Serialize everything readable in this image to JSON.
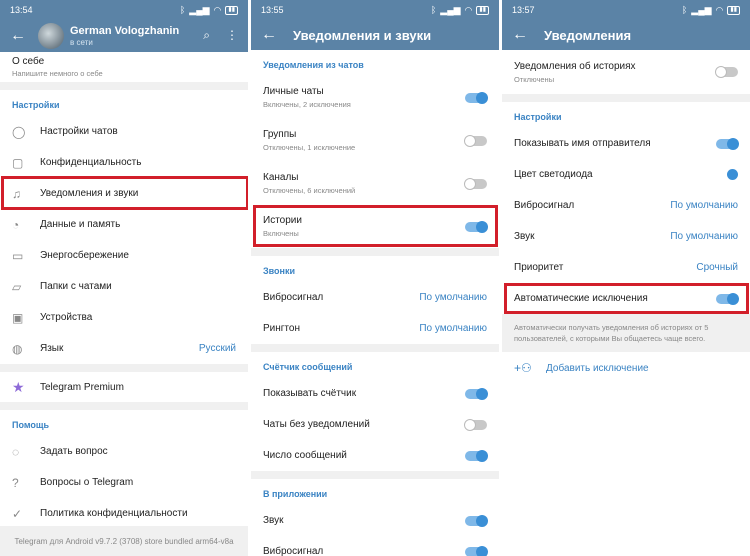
{
  "screen1": {
    "time": "13:54",
    "profile_name": "German Vologzhanin",
    "profile_status": "в сети",
    "about_label": "О себе",
    "about_hint": "Напишите немного о себе",
    "settings_title": "Настройки",
    "items": [
      {
        "label": "Настройки чатов",
        "icon": "chat-bubble-icon"
      },
      {
        "label": "Конфиденциальность",
        "icon": "lock-icon"
      },
      {
        "label": "Уведомления и звуки",
        "icon": "bell-icon"
      },
      {
        "label": "Данные и память",
        "icon": "pie-icon"
      },
      {
        "label": "Энергосбережение",
        "icon": "battery-icon"
      },
      {
        "label": "Папки с чатами",
        "icon": "folder-icon"
      },
      {
        "label": "Устройства",
        "icon": "devices-icon"
      },
      {
        "label": "Язык",
        "icon": "globe-icon",
        "value": "Русский"
      }
    ],
    "premium_label": "Telegram Premium",
    "help_title": "Помощь",
    "help_items": [
      {
        "label": "Задать вопрос"
      },
      {
        "label": "Вопросы о Telegram"
      },
      {
        "label": "Политика конфиденциальности"
      }
    ],
    "footer": "Telegram для Android v9.7.2 (3708) store bundled arm64-v8a"
  },
  "screen2": {
    "time": "13:55",
    "title": "Уведомления и звуки",
    "chats_title": "Уведомления из чатов",
    "chat_rows": [
      {
        "label": "Личные чаты",
        "sub": "Включены, 2 исключения",
        "on": true
      },
      {
        "label": "Группы",
        "sub": "Отключены, 1 исключение",
        "on": false
      },
      {
        "label": "Каналы",
        "sub": "Отключены, 6 исключений",
        "on": false
      },
      {
        "label": "Истории",
        "sub": "Включены",
        "on": true
      }
    ],
    "calls_title": "Звонки",
    "calls_rows": [
      {
        "label": "Вибросигнал",
        "value": "По умолчанию"
      },
      {
        "label": "Рингтон",
        "value": "По умолчанию"
      }
    ],
    "counter_title": "Счётчик сообщений",
    "counter_rows": [
      {
        "label": "Показывать счётчик",
        "on": true
      },
      {
        "label": "Чаты без уведомлений",
        "on": false
      },
      {
        "label": "Число сообщений",
        "on": true
      }
    ],
    "inapp_title": "В приложении",
    "inapp_rows": [
      {
        "label": "Звук",
        "on": true
      },
      {
        "label": "Вибросигнал",
        "on": true
      }
    ]
  },
  "screen3": {
    "time": "13:57",
    "title": "Уведомления",
    "stories_label": "Уведомления об историях",
    "stories_sub": "Отключены",
    "settings_title": "Настройки",
    "rows": [
      {
        "label": "Показывать имя отправителя"
      },
      {
        "label": "Цвет светодиода"
      },
      {
        "label": "Вибросигнал",
        "value": "По умолчанию"
      },
      {
        "label": "Звук",
        "value": "По умолчанию"
      },
      {
        "label": "Приоритет",
        "value": "Срочный"
      }
    ],
    "auto_label": "Автоматические исключения",
    "note": "Автоматически получать уведомления об историях от 5 пользователей, с которыми Вы общаетесь чаще всего.",
    "add_label": "Добавить исключение"
  },
  "colors": {
    "header": "#5b83a6",
    "accent": "#3a83c3",
    "highlight": "#d21f2a"
  }
}
